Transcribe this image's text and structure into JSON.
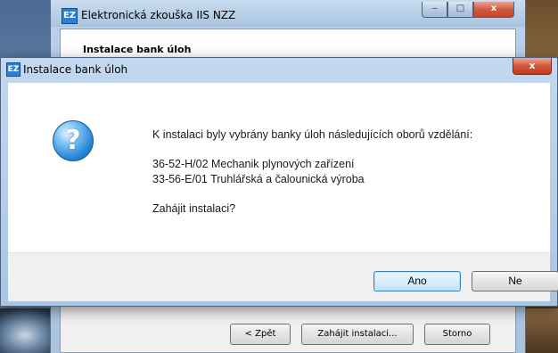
{
  "background_window": {
    "icon_label": "EZ",
    "title": "Elektronická zkouška IIS NZZ",
    "header_title": "Instalace bank úloh",
    "minimize_glyph": "‒",
    "maximize_glyph": "□",
    "close_glyph": "x",
    "buttons": {
      "back": "< Zpět",
      "start": "Zahájit instalaci...",
      "cancel": "Storno"
    }
  },
  "dialog": {
    "icon_label": "EZ",
    "title": "Instalace bank úloh",
    "close_glyph": "x",
    "question_glyph": "?",
    "message": {
      "intro": "K instalaci byly vybrány banky úloh následujících oborů vzdělání:",
      "items": [
        "36-52-H/02 Mechanik plynových zařízení",
        "33-56-E/01 Truhlářská a čalounická výroba"
      ],
      "question": "Zahájit instalaci?"
    },
    "buttons": {
      "yes": "Ano",
      "no": "Ne"
    }
  },
  "colors": {
    "titlebar": "#aac5e2",
    "close": "#c24428",
    "default_button": "#bee6fd"
  }
}
